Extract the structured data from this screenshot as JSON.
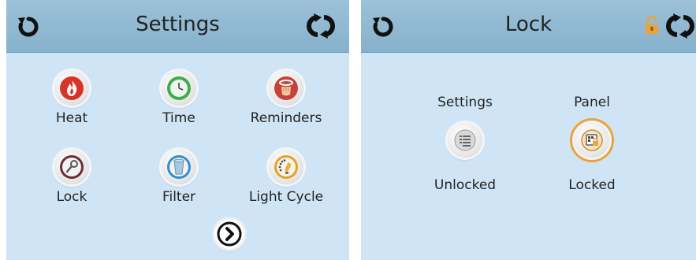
{
  "settings_screen": {
    "title": "Settings",
    "icons": {
      "back": "back-arrow-icon",
      "refresh": "refresh-icon",
      "next": "next-arrow-icon"
    },
    "items": [
      {
        "label": "Heat",
        "icon": "flame-icon",
        "color": "#d8332a"
      },
      {
        "label": "Time",
        "icon": "clock-icon",
        "color": "#3fae4a"
      },
      {
        "label": "Reminders",
        "icon": "reminder-hand-icon",
        "color": "#c7413b"
      },
      {
        "label": "Lock",
        "icon": "key-icon",
        "color": "#6b2d36"
      },
      {
        "label": "Filter",
        "icon": "filter-icon",
        "color": "#2f8fd0"
      },
      {
        "label": "Light Cycle",
        "icon": "light-cycle-icon",
        "color": "#e3a326"
      }
    ]
  },
  "lock_screen": {
    "title": "Lock",
    "icons": {
      "back": "back-arrow-icon",
      "refresh": "refresh-icon",
      "status": "padlock-open-icon"
    },
    "columns": [
      {
        "title": "Settings",
        "state": "Unlocked",
        "icon": "settings-list-icon",
        "locked": false
      },
      {
        "title": "Panel",
        "state": "Locked",
        "icon": "panel-locked-icon",
        "locked": true
      }
    ]
  },
  "colors": {
    "background": "#cfe5f5",
    "header": "#8fb7d0",
    "accent_orange": "#e9a33b"
  }
}
